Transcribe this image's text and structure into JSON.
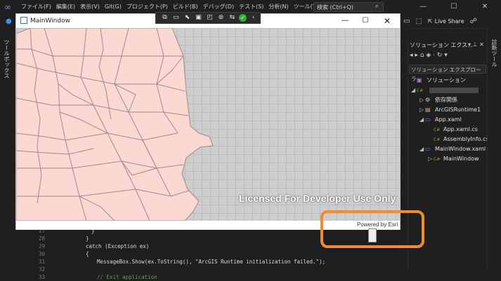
{
  "vs": {
    "menu": [
      "ファイル(F)",
      "編集(E)",
      "表示(V)",
      "Git(G)",
      "プロジェクト(P)",
      "ビルド(B)",
      "デバッグ(D)",
      "テスト(S)",
      "分析(N)",
      "ツール(T)"
    ],
    "search_placeholder": "検索 (Ctrl+Q)",
    "live_share": "Live Share",
    "toolbox_label": "ツールボックス",
    "diagnostics_label": "診断ツール"
  },
  "solution_explorer": {
    "title": "ソリューション エクス...",
    "search_placeholder": "ソリューション エクスプローラー",
    "items": [
      {
        "label": "ソリューション",
        "icon": "solution-icon"
      },
      {
        "label": "",
        "icon": "csharp-project-icon"
      },
      {
        "label": "依存関係",
        "icon": "dependencies-icon"
      },
      {
        "label": "ArcGISRuntime1",
        "icon": "folder-icon"
      },
      {
        "label": "App.xaml",
        "icon": "xaml-file-icon"
      },
      {
        "label": "App.xaml.cs",
        "icon": "csharp-file-icon"
      },
      {
        "label": "AssemblyInfo.cs",
        "icon": "csharp-file-icon"
      },
      {
        "label": "MainWindow.xaml",
        "icon": "xaml-file-icon"
      },
      {
        "label": "MainWindow",
        "icon": "csharp-file-icon"
      }
    ]
  },
  "editor": {
    "lines": [
      {
        "num": "27",
        "code": "}"
      },
      {
        "num": "28",
        "code": "}"
      },
      {
        "num": "29",
        "code": "catch (Exception ex)"
      },
      {
        "num": "30",
        "code": "{"
      },
      {
        "num": "31",
        "code": "MessageBox.Show(ex.ToString(), \"ArcGIS Runtime initialization failed.\");"
      },
      {
        "num": "32",
        "code": ""
      },
      {
        "num": "33",
        "code": "// Exit application"
      }
    ]
  },
  "app": {
    "title": "MainWindow",
    "license_text": "Licensed For Developer Use Only",
    "attribution": "Powered by Esri",
    "polygon_fill": "#fcd8d2",
    "polygon_stroke": "#9a8c8a"
  },
  "annotation": {
    "color": "#f28a2e"
  }
}
